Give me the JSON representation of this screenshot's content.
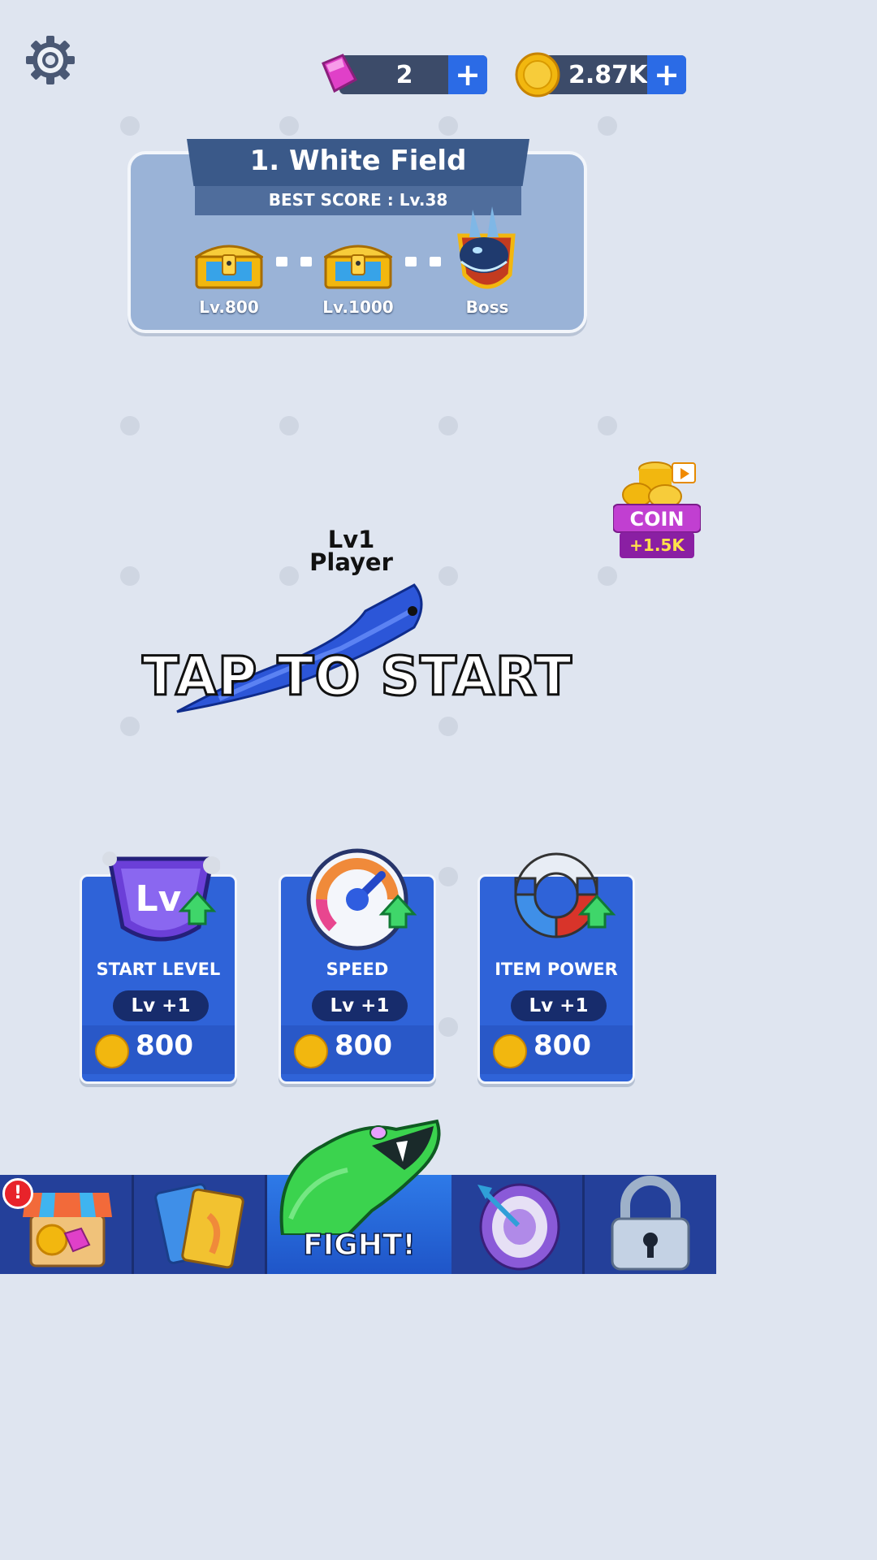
{
  "currency": {
    "gems": "2",
    "coins": "2.87K",
    "plus": "+"
  },
  "stage": {
    "title": "1. White Field",
    "best_score": "BEST SCORE : Lv.38",
    "milestones": [
      {
        "label": "Lv.800",
        "icon": "chest-icon"
      },
      {
        "label": "Lv.1000",
        "icon": "chest-icon"
      },
      {
        "label": "Boss",
        "icon": "dragon-boss-icon"
      }
    ]
  },
  "coin_offer": {
    "label": "COIN",
    "amount": "+1.5K",
    "icon": "video-ad-icon"
  },
  "player": {
    "level": "Lv1",
    "name": "Player"
  },
  "prompt": "TAP TO START",
  "upgrades": [
    {
      "title": "START LEVEL",
      "level": "Lv +1",
      "cost": "800",
      "icon": "level-shield-icon"
    },
    {
      "title": "SPEED",
      "level": "Lv +1",
      "cost": "800",
      "icon": "speedometer-icon"
    },
    {
      "title": "ITEM POWER",
      "level": "Lv +1",
      "cost": "800",
      "icon": "magnet-icon"
    }
  ],
  "nav": {
    "fight": "FIGHT!",
    "notification": "!",
    "items": [
      "shop-icon",
      "cards-icon",
      "snake-head-icon",
      "target-icon",
      "lock-icon"
    ]
  },
  "colors": {
    "background": "#dfe5f0",
    "nav": "#223a8c",
    "card": "#2f63d8",
    "accent_plus": "#2b6be6",
    "gem": "#e040c8",
    "coin": "#f2b70f"
  }
}
